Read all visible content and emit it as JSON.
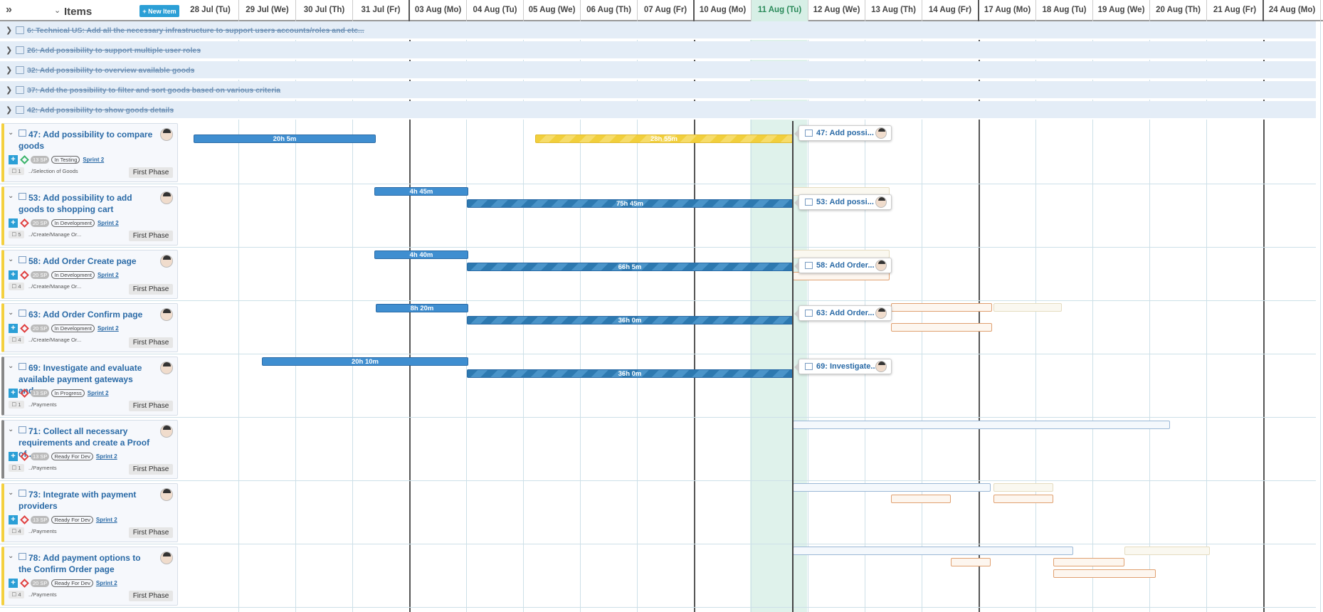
{
  "header": {
    "items_title": "Items",
    "new_item_label": "+ New Item",
    "days": [
      "28 Jul (Tu)",
      "29 Jul (We)",
      "30 Jul (Th)",
      "31 Jul (Fr)",
      "03 Aug (Mo)",
      "04 Aug (Tu)",
      "05 Aug (We)",
      "06 Aug (Th)",
      "07 Aug (Fr)",
      "10 Aug (Mo)",
      "11 Aug (Tu)",
      "12 Aug (We)",
      "13 Aug (Th)",
      "14 Aug (Fr)",
      "17 Aug (Mo)",
      "18 Aug (Tu)",
      "19 Aug (We)",
      "20 Aug (Th)",
      "21 Aug (Fr)",
      "24 Aug (Mo)"
    ],
    "today": "11 Aug (Tu)"
  },
  "epics": [
    {
      "label": "6: Technical US: Add all the necessary infrastructure to support users accounts/roles and etc..."
    },
    {
      "label": "26: Add possibility to support multiple user roles"
    },
    {
      "label": "32: Add possibility to overview available goods"
    },
    {
      "label": "37: Add the possibility to filter and sort goods based on various criteria"
    },
    {
      "label": "42: Add possibility to show goods details"
    }
  ],
  "rows": [
    {
      "title": "47: Add possibility to compare goods",
      "sp": "13 SP",
      "status": "In Testing",
      "sprint": "Sprint 2",
      "count": "1",
      "path": "../Selection of Goods",
      "phase": "First Phase",
      "popup": "47: Add possi...",
      "bars": [
        "20h 5m",
        "28h 55m"
      ]
    },
    {
      "title": "53: Add possibility to add goods to shopping cart",
      "sp": "20 SP",
      "status": "In Development",
      "sprint": "Sprint 2",
      "count": "5",
      "path": "../Create/Manage Or...",
      "phase": "First Phase",
      "popup": "53: Add possi...",
      "bars": [
        "4h 45m",
        "75h 45m"
      ]
    },
    {
      "title": "58: Add Order Create page",
      "sp": "20 SP",
      "status": "In Development",
      "sprint": "Sprint 2",
      "count": "4",
      "path": "../Create/Manage Or...",
      "phase": "First Phase",
      "popup": "58: Add Order...",
      "bars": [
        "4h 40m",
        "66h 5m"
      ]
    },
    {
      "title": "63: Add Order Confirm page",
      "sp": "20 SP",
      "status": "In Development",
      "sprint": "Sprint 2",
      "count": "4",
      "path": "../Create/Manage Or...",
      "phase": "First Phase",
      "popup": "63: Add Order...",
      "bars": [
        "8h 20m",
        "36h 0m"
      ]
    },
    {
      "title": "69: Investigate and evaluate available payment gateways and...",
      "sp": "13 SP",
      "status": "In Progress",
      "sprint": "Sprint 2",
      "count": "1",
      "path": "../Payments",
      "phase": "First Phase",
      "popup": "69: Investigate...",
      "bars": [
        "20h 10m",
        "36h 0m"
      ]
    },
    {
      "title": "71: Collect all necessary requirements and create a Proof of...",
      "sp": "13 SP",
      "status": "Ready For Dev",
      "sprint": "Sprint 2",
      "count": "1",
      "path": "../Payments",
      "phase": "First Phase"
    },
    {
      "title": "73: Integrate with payment providers",
      "sp": "13 SP",
      "status": "Ready For Dev",
      "sprint": "Sprint 2",
      "count": "4",
      "path": "../Payments",
      "phase": "First Phase"
    },
    {
      "title": "78: Add payment options to the Confirm Order page",
      "sp": "20 SP",
      "status": "Ready For Dev",
      "sprint": "Sprint 2",
      "count": "4",
      "path": "../Payments",
      "phase": "First Phase"
    }
  ]
}
